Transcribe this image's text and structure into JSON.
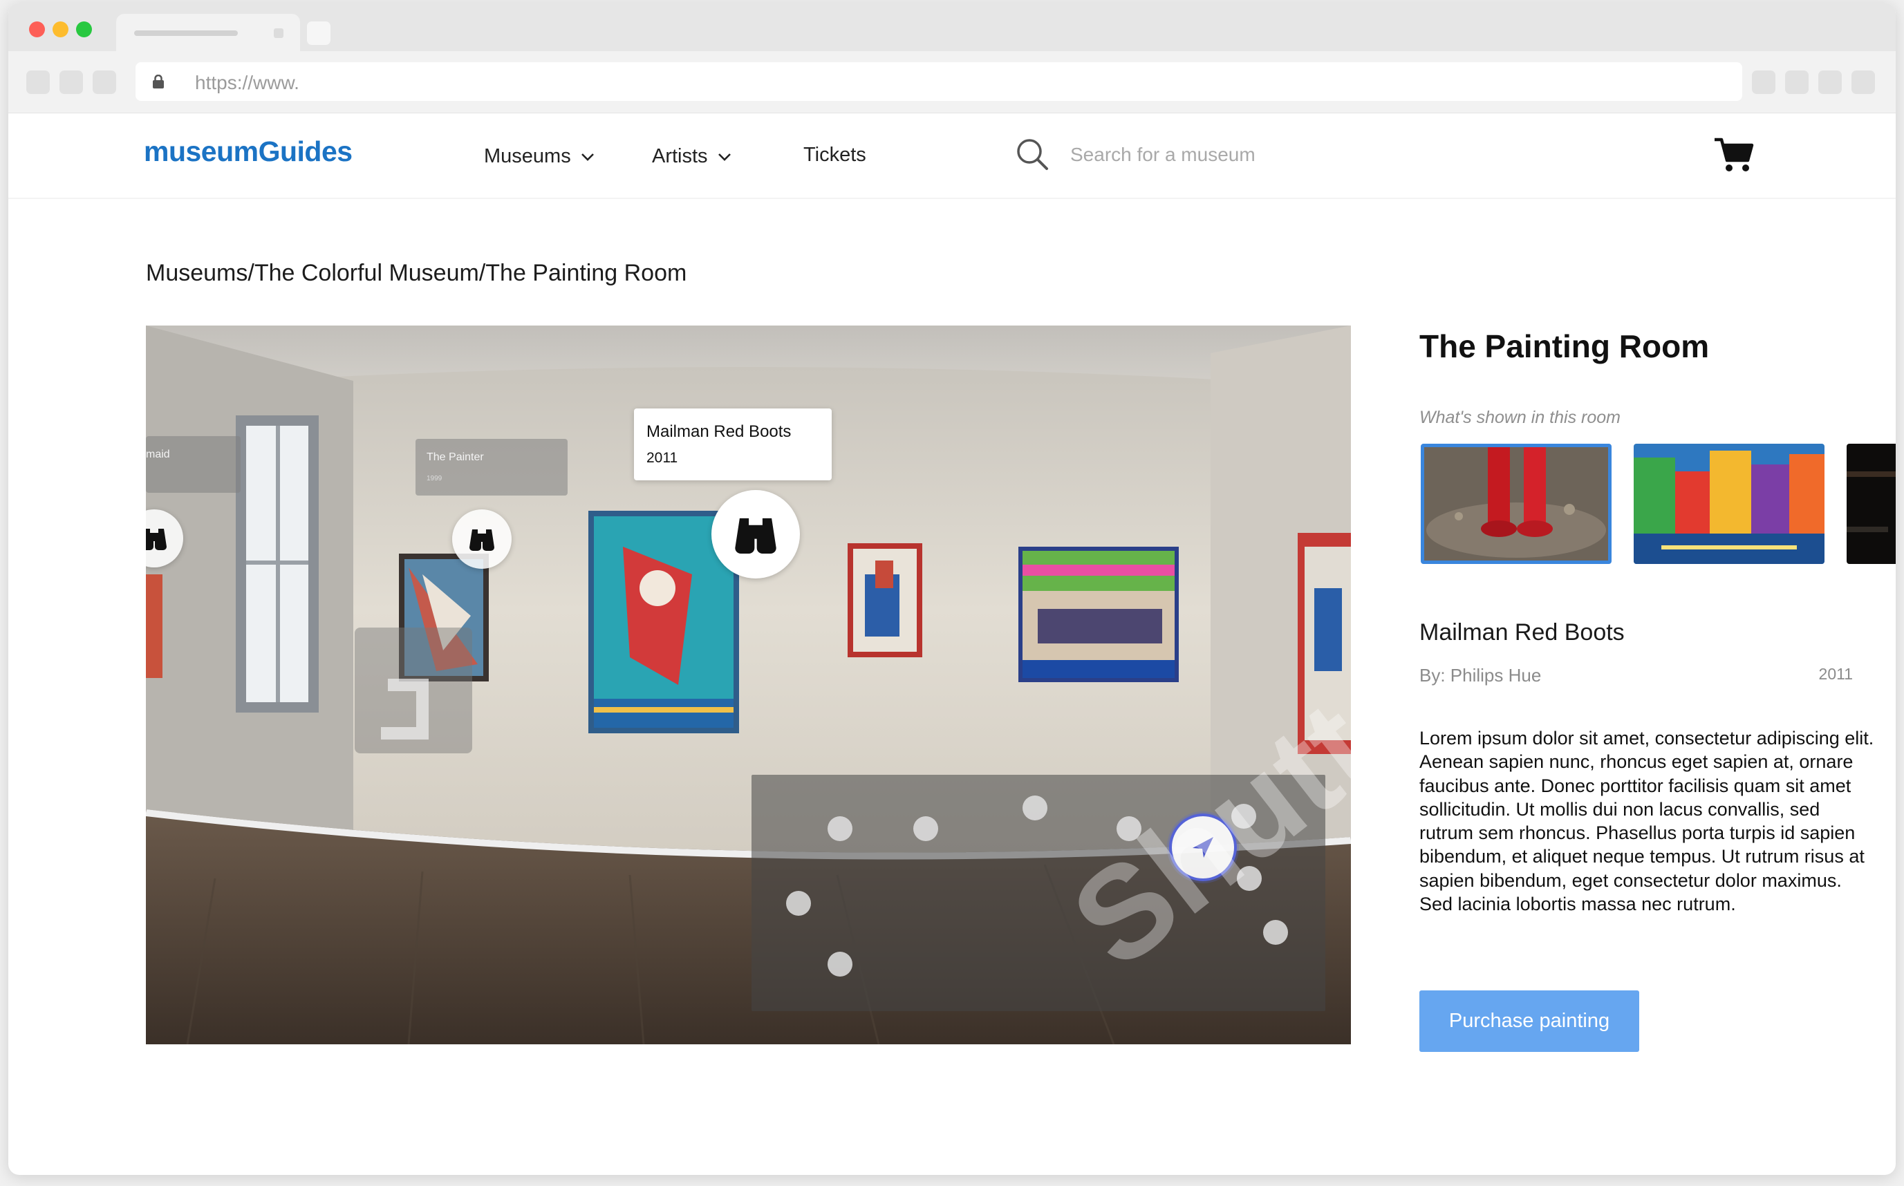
{
  "browser": {
    "url": "https://www."
  },
  "header": {
    "logo": "museumGuides",
    "nav": [
      {
        "label": "Museums"
      },
      {
        "label": "Artists"
      },
      {
        "label": "Tickets"
      }
    ],
    "search_placeholder": "Search for a museum"
  },
  "breadcrumb": "Museums/The Colorful Museum/The Painting Room",
  "viewer": {
    "labels": [
      {
        "title": "maid"
      },
      {
        "title": "The Painter",
        "year": "1999"
      },
      {
        "title": "Mailman Red Boots",
        "year": "2011"
      }
    ],
    "watermark": "Shutte"
  },
  "panel": {
    "title": "The Painting Room",
    "subtitle": "What's shown in this room",
    "artwork": {
      "title": "Mailman Red Boots",
      "artist": "By: Philips Hue",
      "year": "2011",
      "description": "Lorem ipsum dolor sit amet, consectetur adipiscing elit. Aenean sapien nunc, rhoncus eget sapien at, ornare faucibus ante. Donec porttitor facilisis quam sit amet sollicitudin. Ut mollis dui non lacus convallis, sed rutrum sem rhoncus. Phasellus porta turpis id sapien bibendum, et aliquet neque tempus. Ut rutrum risus at sapien bibendum, eget consectetur dolor maximus. Sed lacinia lobortis massa nec rutrum."
    },
    "purchase_label": "Purchase painting"
  },
  "colors": {
    "brand": "#1b73c4",
    "button": "#66a6f0",
    "selection": "#3a86dd",
    "compass": "#5563d6"
  },
  "icons": [
    "lock-icon",
    "chevron-down-icon",
    "search-icon",
    "cart-icon",
    "binoculars-icon",
    "navigation-arrow-icon"
  ]
}
